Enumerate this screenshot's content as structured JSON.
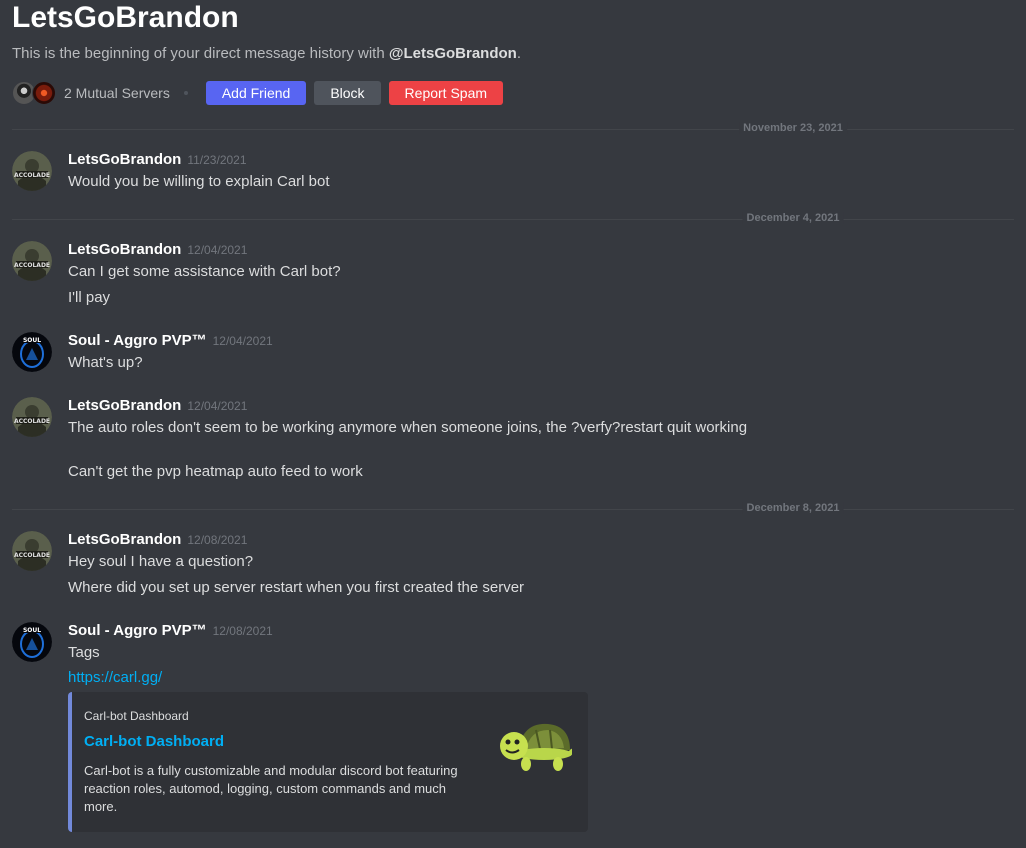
{
  "header": {
    "title": "LetsGoBrandon",
    "subtitle_prefix": "This is the beginning of your direct message history with ",
    "subtitle_mention": "@LetsGoBrandon",
    "subtitle_suffix": ".",
    "mutual_servers": "2 Mutual Servers",
    "add_friend": "Add Friend",
    "block": "Block",
    "report_spam": "Report Spam"
  },
  "dividers": [
    "November 23, 2021",
    "December 4, 2021",
    "December 8, 2021"
  ],
  "messages": [
    {
      "author": "LetsGoBrandon",
      "avatar": "accolade-avatar",
      "time": "11/23/2021",
      "lines": [
        "Would you be willing to explain Carl bot"
      ]
    },
    {
      "author": "LetsGoBrandon",
      "avatar": "accolade-avatar",
      "time": "12/04/2021",
      "lines": [
        "Can I get some assistance with Carl bot?",
        "I'll pay"
      ]
    },
    {
      "author": "Soul - Aggro PVP™",
      "avatar": "soul-avatar",
      "time": "12/04/2021",
      "lines": [
        "What's up?"
      ]
    },
    {
      "author": "LetsGoBrandon",
      "avatar": "accolade-avatar",
      "time": "12/04/2021",
      "lines": [
        "The auto roles don't seem to be working anymore when someone joins, the ?verfy?restart quit working",
        "Can't get the pvp heatmap auto feed to work"
      ]
    },
    {
      "author": "LetsGoBrandon",
      "avatar": "accolade-avatar",
      "time": "12/08/2021",
      "lines": [
        "Hey soul I have a question?",
        "Where did you set up server restart when you first created the server"
      ]
    },
    {
      "author": "Soul - Aggro PVP™",
      "avatar": "soul-avatar",
      "time": "12/08/2021",
      "lines": [
        "Tags"
      ],
      "link": "https://carl.gg/"
    }
  ],
  "embed": {
    "provider": "Carl-bot Dashboard",
    "title": "Carl-bot Dashboard",
    "description": "Carl-bot is a fully customizable and modular discord bot featuring reaction roles, automod, logging, custom commands and much more.",
    "thumbnail": "turtle-icon"
  },
  "colors": {
    "background": "#36393f",
    "blurple": "#5865f2",
    "danger": "#ed4245",
    "link": "#00aff4",
    "embed_bar": "#7289da"
  }
}
